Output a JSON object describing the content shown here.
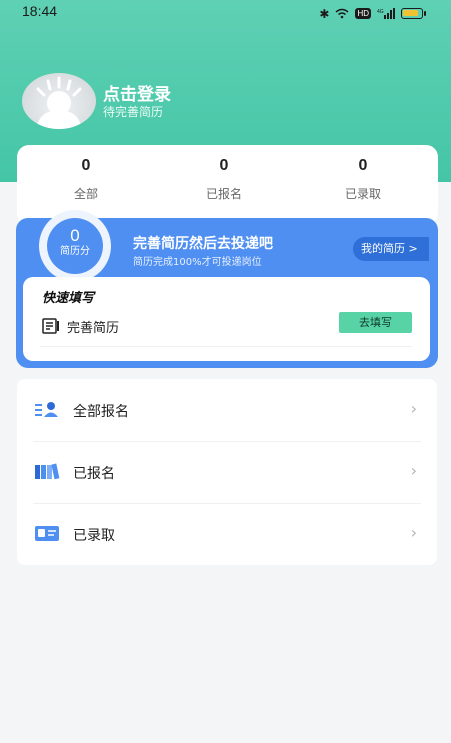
{
  "status_bar": {
    "time": "18:44",
    "hd": "HD",
    "network": "4G"
  },
  "profile": {
    "login_title": "点击登录",
    "subtitle": "待完善简历"
  },
  "stats": [
    {
      "value": "0",
      "label": "全部"
    },
    {
      "value": "0",
      "label": "已报名"
    },
    {
      "value": "0",
      "label": "已录取"
    }
  ],
  "resume": {
    "score": "0",
    "score_label": "简历分",
    "title": "完善简历然后去投递吧",
    "subtitle": "简历完成100%才可投递岗位",
    "my_resume": "我的简历 >"
  },
  "quick_fill": {
    "title": "快速填写",
    "item_label": "完善简历",
    "button": "去填写"
  },
  "menu": [
    {
      "label": "全部报名",
      "icon": "people-list-icon"
    },
    {
      "label": "已报名",
      "icon": "books-icon"
    },
    {
      "label": "已录取",
      "icon": "id-card-icon"
    }
  ],
  "colors": {
    "header": "#4cc9a9",
    "accent_blue": "#4f8ff2",
    "fill_button": "#57d3a6"
  }
}
